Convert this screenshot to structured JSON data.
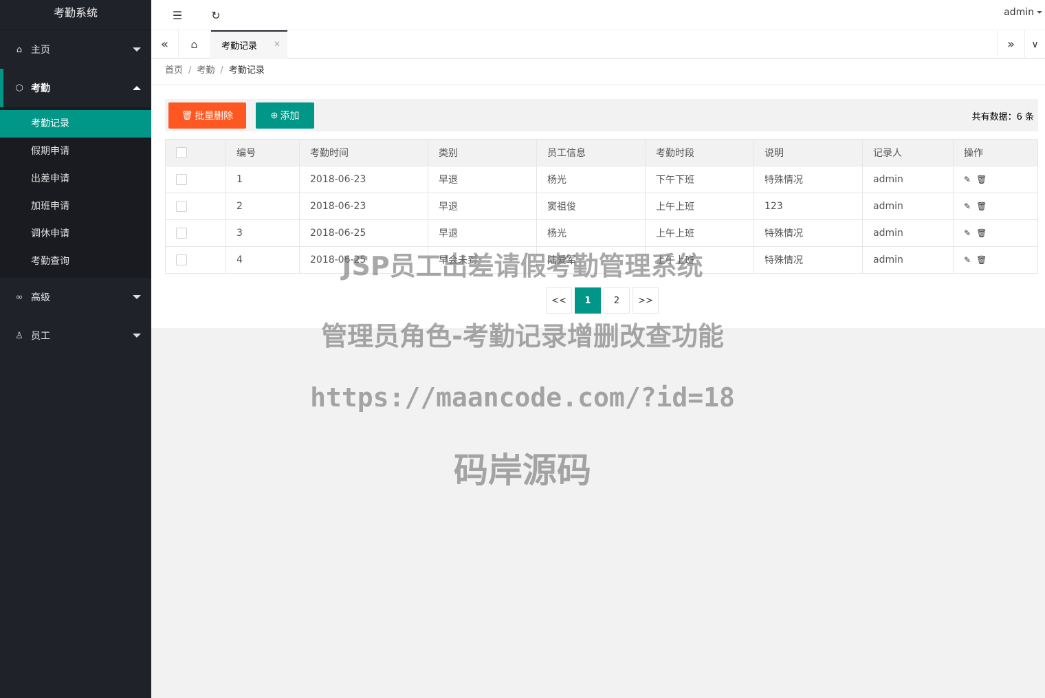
{
  "app_title": "考勤系统",
  "user": "admin",
  "sidebar": {
    "groups": [
      {
        "label": "主页",
        "icon": "home-icon"
      },
      {
        "label": "考勤",
        "icon": "cube-icon",
        "items": [
          "考勤记录",
          "假期申请",
          "出差申请",
          "加班申请",
          "调休申请",
          "考勤查询"
        ]
      },
      {
        "label": "高级",
        "icon": "link-icon"
      },
      {
        "label": "员工",
        "icon": "user-icon"
      }
    ]
  },
  "tabs": {
    "active": "考勤记录"
  },
  "breadcrumb": {
    "home": "首页",
    "parent": "考勤",
    "current": "考勤记录"
  },
  "toolbar": {
    "batch_delete": "批量删除",
    "add": "添加",
    "total": "共有数据：6 条"
  },
  "table": {
    "headers": [
      "编号",
      "考勤时间",
      "类别",
      "员工信息",
      "考勤时段",
      "说明",
      "记录人",
      "操作"
    ],
    "rows": [
      [
        "1",
        "2018-06-23",
        "早退",
        "杨光",
        "下午下班",
        "特殊情况",
        "admin"
      ],
      [
        "2",
        "2018-06-23",
        "早退",
        "窦祖俊",
        "上午上班",
        "123",
        "admin"
      ],
      [
        "3",
        "2018-06-25",
        "早退",
        "杨光",
        "上午上班",
        "特殊情况",
        "admin"
      ],
      [
        "4",
        "2018-06-25",
        "早会未到",
        "陆爱军",
        "上午上班",
        "特殊情况",
        "admin"
      ]
    ]
  },
  "pager": {
    "prev": "<<",
    "pages": [
      "1",
      "2"
    ],
    "next": ">>"
  },
  "watermark": {
    "line1": "JSP员工出差请假考勤管理系统",
    "line2": "管理员角色-考勤记录增删改查功能",
    "line3": "https://maancode.com/?id=18",
    "line4": "码岸源码"
  }
}
